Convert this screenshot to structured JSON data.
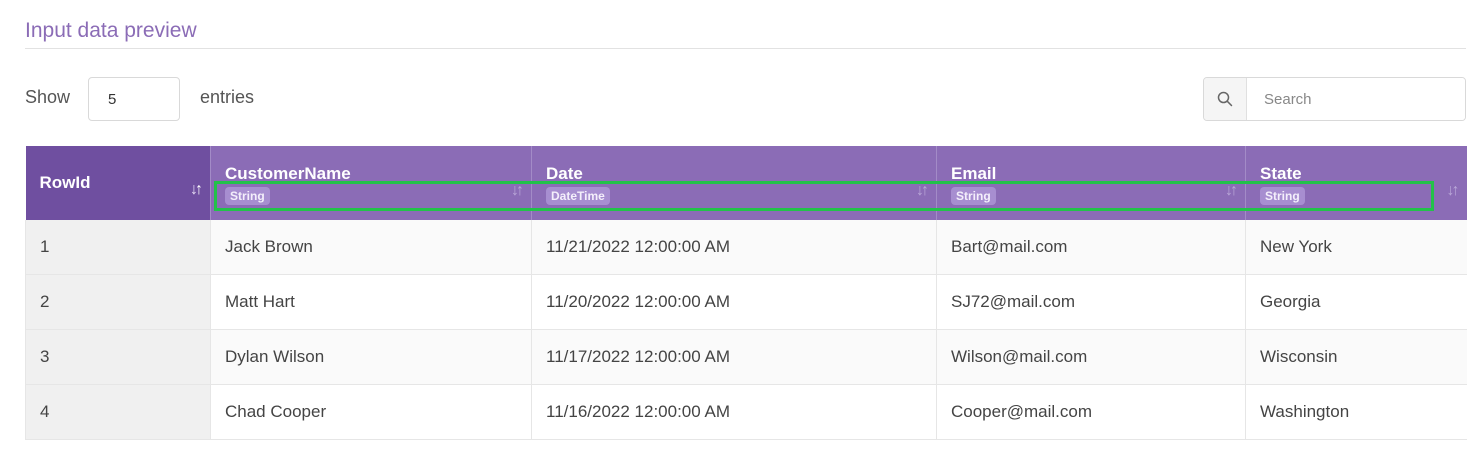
{
  "section": {
    "title": "Input data preview"
  },
  "length": {
    "show_label": "Show",
    "value": "5",
    "entries_label": "entries"
  },
  "search": {
    "placeholder": "Search",
    "icon": "search-icon"
  },
  "table": {
    "columns": [
      {
        "name": "RowId",
        "type": ""
      },
      {
        "name": "CustomerName",
        "type": "String"
      },
      {
        "name": "Date",
        "type": "DateTime"
      },
      {
        "name": "Email",
        "type": "String"
      },
      {
        "name": "State",
        "type": "String"
      }
    ],
    "rows": [
      [
        "1",
        "Jack Brown",
        "11/21/2022 12:00:00 AM",
        "Bart@mail.com",
        "New York"
      ],
      [
        "2",
        "Matt Hart",
        "11/20/2022 12:00:00 AM",
        "SJ72@mail.com",
        "Georgia"
      ],
      [
        "3",
        "Dylan Wilson",
        "11/17/2022 12:00:00 AM",
        "Wilson@mail.com",
        "Wisconsin"
      ],
      [
        "4",
        "Chad Cooper",
        "11/16/2022 12:00:00 AM",
        "Cooper@mail.com",
        "Washington"
      ]
    ]
  },
  "colors": {
    "accent": "#8b6cb6",
    "accent_dark": "#6f4fa0",
    "highlight": "#22c24a"
  }
}
